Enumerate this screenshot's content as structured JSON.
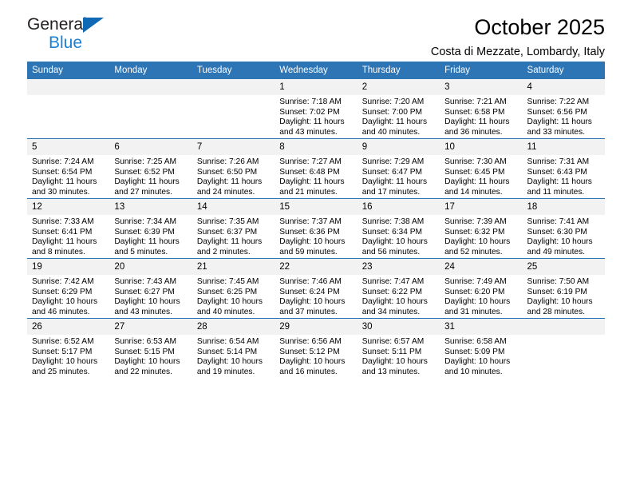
{
  "brand": {
    "name_top": "General",
    "name_bottom": "Blue",
    "triangle_color": "#1069b4",
    "blue_color": "#1b80d4"
  },
  "header": {
    "title": "October 2025",
    "subtitle": "Costa di Mezzate, Lombardy, Italy"
  },
  "theme": {
    "header_bg": "#2e75b6",
    "daynum_bg": "#f2f2f2",
    "grid_line": "#2e75b6"
  },
  "weekday_headers": [
    "Sunday",
    "Monday",
    "Tuesday",
    "Wednesday",
    "Thursday",
    "Friday",
    "Saturday"
  ],
  "weeks": [
    [
      {
        "day": "",
        "lines": []
      },
      {
        "day": "",
        "lines": []
      },
      {
        "day": "",
        "lines": []
      },
      {
        "day": "1",
        "lines": [
          "Sunrise: 7:18 AM",
          "Sunset: 7:02 PM",
          "Daylight: 11 hours",
          "and 43 minutes."
        ]
      },
      {
        "day": "2",
        "lines": [
          "Sunrise: 7:20 AM",
          "Sunset: 7:00 PM",
          "Daylight: 11 hours",
          "and 40 minutes."
        ]
      },
      {
        "day": "3",
        "lines": [
          "Sunrise: 7:21 AM",
          "Sunset: 6:58 PM",
          "Daylight: 11 hours",
          "and 36 minutes."
        ]
      },
      {
        "day": "4",
        "lines": [
          "Sunrise: 7:22 AM",
          "Sunset: 6:56 PM",
          "Daylight: 11 hours",
          "and 33 minutes."
        ]
      }
    ],
    [
      {
        "day": "5",
        "lines": [
          "Sunrise: 7:24 AM",
          "Sunset: 6:54 PM",
          "Daylight: 11 hours",
          "and 30 minutes."
        ]
      },
      {
        "day": "6",
        "lines": [
          "Sunrise: 7:25 AM",
          "Sunset: 6:52 PM",
          "Daylight: 11 hours",
          "and 27 minutes."
        ]
      },
      {
        "day": "7",
        "lines": [
          "Sunrise: 7:26 AM",
          "Sunset: 6:50 PM",
          "Daylight: 11 hours",
          "and 24 minutes."
        ]
      },
      {
        "day": "8",
        "lines": [
          "Sunrise: 7:27 AM",
          "Sunset: 6:48 PM",
          "Daylight: 11 hours",
          "and 21 minutes."
        ]
      },
      {
        "day": "9",
        "lines": [
          "Sunrise: 7:29 AM",
          "Sunset: 6:47 PM",
          "Daylight: 11 hours",
          "and 17 minutes."
        ]
      },
      {
        "day": "10",
        "lines": [
          "Sunrise: 7:30 AM",
          "Sunset: 6:45 PM",
          "Daylight: 11 hours",
          "and 14 minutes."
        ]
      },
      {
        "day": "11",
        "lines": [
          "Sunrise: 7:31 AM",
          "Sunset: 6:43 PM",
          "Daylight: 11 hours",
          "and 11 minutes."
        ]
      }
    ],
    [
      {
        "day": "12",
        "lines": [
          "Sunrise: 7:33 AM",
          "Sunset: 6:41 PM",
          "Daylight: 11 hours",
          "and 8 minutes."
        ]
      },
      {
        "day": "13",
        "lines": [
          "Sunrise: 7:34 AM",
          "Sunset: 6:39 PM",
          "Daylight: 11 hours",
          "and 5 minutes."
        ]
      },
      {
        "day": "14",
        "lines": [
          "Sunrise: 7:35 AM",
          "Sunset: 6:37 PM",
          "Daylight: 11 hours",
          "and 2 minutes."
        ]
      },
      {
        "day": "15",
        "lines": [
          "Sunrise: 7:37 AM",
          "Sunset: 6:36 PM",
          "Daylight: 10 hours",
          "and 59 minutes."
        ]
      },
      {
        "day": "16",
        "lines": [
          "Sunrise: 7:38 AM",
          "Sunset: 6:34 PM",
          "Daylight: 10 hours",
          "and 56 minutes."
        ]
      },
      {
        "day": "17",
        "lines": [
          "Sunrise: 7:39 AM",
          "Sunset: 6:32 PM",
          "Daylight: 10 hours",
          "and 52 minutes."
        ]
      },
      {
        "day": "18",
        "lines": [
          "Sunrise: 7:41 AM",
          "Sunset: 6:30 PM",
          "Daylight: 10 hours",
          "and 49 minutes."
        ]
      }
    ],
    [
      {
        "day": "19",
        "lines": [
          "Sunrise: 7:42 AM",
          "Sunset: 6:29 PM",
          "Daylight: 10 hours",
          "and 46 minutes."
        ]
      },
      {
        "day": "20",
        "lines": [
          "Sunrise: 7:43 AM",
          "Sunset: 6:27 PM",
          "Daylight: 10 hours",
          "and 43 minutes."
        ]
      },
      {
        "day": "21",
        "lines": [
          "Sunrise: 7:45 AM",
          "Sunset: 6:25 PM",
          "Daylight: 10 hours",
          "and 40 minutes."
        ]
      },
      {
        "day": "22",
        "lines": [
          "Sunrise: 7:46 AM",
          "Sunset: 6:24 PM",
          "Daylight: 10 hours",
          "and 37 minutes."
        ]
      },
      {
        "day": "23",
        "lines": [
          "Sunrise: 7:47 AM",
          "Sunset: 6:22 PM",
          "Daylight: 10 hours",
          "and 34 minutes."
        ]
      },
      {
        "day": "24",
        "lines": [
          "Sunrise: 7:49 AM",
          "Sunset: 6:20 PM",
          "Daylight: 10 hours",
          "and 31 minutes."
        ]
      },
      {
        "day": "25",
        "lines": [
          "Sunrise: 7:50 AM",
          "Sunset: 6:19 PM",
          "Daylight: 10 hours",
          "and 28 minutes."
        ]
      }
    ],
    [
      {
        "day": "26",
        "lines": [
          "Sunrise: 6:52 AM",
          "Sunset: 5:17 PM",
          "Daylight: 10 hours",
          "and 25 minutes."
        ]
      },
      {
        "day": "27",
        "lines": [
          "Sunrise: 6:53 AM",
          "Sunset: 5:15 PM",
          "Daylight: 10 hours",
          "and 22 minutes."
        ]
      },
      {
        "day": "28",
        "lines": [
          "Sunrise: 6:54 AM",
          "Sunset: 5:14 PM",
          "Daylight: 10 hours",
          "and 19 minutes."
        ]
      },
      {
        "day": "29",
        "lines": [
          "Sunrise: 6:56 AM",
          "Sunset: 5:12 PM",
          "Daylight: 10 hours",
          "and 16 minutes."
        ]
      },
      {
        "day": "30",
        "lines": [
          "Sunrise: 6:57 AM",
          "Sunset: 5:11 PM",
          "Daylight: 10 hours",
          "and 13 minutes."
        ]
      },
      {
        "day": "31",
        "lines": [
          "Sunrise: 6:58 AM",
          "Sunset: 5:09 PM",
          "Daylight: 10 hours",
          "and 10 minutes."
        ]
      },
      {
        "day": "",
        "lines": []
      }
    ]
  ]
}
